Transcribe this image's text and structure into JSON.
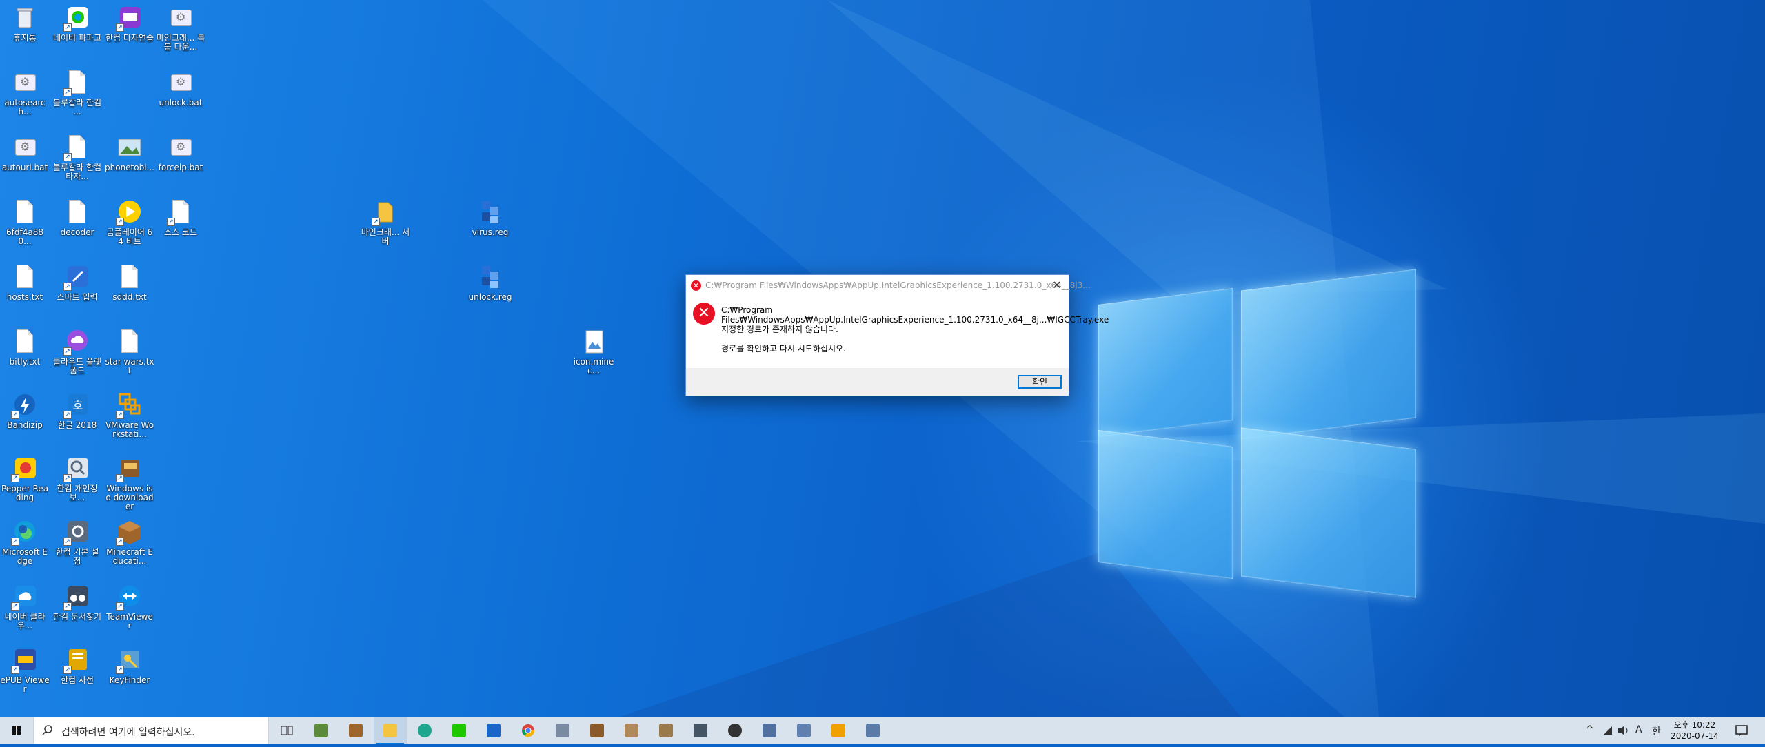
{
  "desktop_icons": [
    {
      "label": "휴지통"
    },
    {
      "label": "네이버 파파고"
    },
    {
      "label": "한컴 타자연습"
    },
    {
      "label": "마인크래... 복붙 다운..."
    },
    {
      "label": "autosearch..."
    },
    {
      "label": "블루칼라 한컴 ..."
    },
    {
      "label": "unlock.bat"
    },
    {
      "label": "autourl.bat"
    },
    {
      "label": "블루칼라 한컴타자..."
    },
    {
      "label": "phonetobi..."
    },
    {
      "label": "forceip.bat"
    },
    {
      "label": "6fdf4a880..."
    },
    {
      "label": "decoder"
    },
    {
      "label": "곰플레이어 64 비트"
    },
    {
      "label": "소스 코드"
    },
    {
      "label": "마인크래... 서버"
    },
    {
      "label": "virus.reg"
    },
    {
      "label": "hosts.txt"
    },
    {
      "label": "스마트 입력"
    },
    {
      "label": "sddd.txt"
    },
    {
      "label": "unlock.reg"
    },
    {
      "label": "bitly.txt"
    },
    {
      "label": "클라우드 플랫폼드"
    },
    {
      "label": "star wars.txt"
    },
    {
      "label": "icon.minec..."
    },
    {
      "label": "Bandizip"
    },
    {
      "label": "한글 2018"
    },
    {
      "label": "VMware Workstati..."
    },
    {
      "label": "Pepper Reading"
    },
    {
      "label": "한컴 개인정보..."
    },
    {
      "label": "Windows iso downloader"
    },
    {
      "label": "Microsoft Edge"
    },
    {
      "label": "한컴 기본 설정"
    },
    {
      "label": "Minecraft Educati..."
    },
    {
      "label": "네이버 클라우..."
    },
    {
      "label": "한컴 문서찾기"
    },
    {
      "label": "TeamViewer"
    },
    {
      "label": "ePUB Viewer"
    },
    {
      "label": "한컴 사전"
    },
    {
      "label": "KeyFinder"
    }
  ],
  "dialog": {
    "title": "C:₩Program Files₩WindowsApps₩AppUp.IntelGraphicsExperience_1.100.2731.0_x64__8j3...",
    "message_line1": "C:₩Program",
    "message_line2": "Files₩WindowsApps₩AppUp.IntelGraphicsExperience_1.100.2731.0_x64__8j...₩IGCCTray.exe",
    "message_line3": "지정한 경로가 존재하지 않습니다.",
    "message_line4": "경로를 확인하고 다시 시도하십시오.",
    "ok_label": "확인",
    "close_glyph": "✕",
    "error_glyph": "✕"
  },
  "taskbar": {
    "search_placeholder": "검색하려면 여기에 입력하십시오.",
    "apps": [
      "task-view",
      "minecraft",
      "minecraft-edu",
      "file-explorer",
      "edge-beta",
      "papago",
      "teamviewer-chat",
      "chrome",
      "hancom-tool",
      "minecraft-2",
      "pickaxe",
      "pickaxe-2",
      "network-tool",
      "chat-tool",
      "remote-1",
      "remote-2",
      "vmware",
      "remote-3"
    ],
    "active_app": "file-explorer",
    "tray": {
      "chevron": "^",
      "ime_mode": "A",
      "ime_lang": "한",
      "time": "오후 10:22",
      "date": "2020-07-14"
    }
  },
  "colors": {
    "desktop_blue": "#0f6fd6",
    "error_red": "#e81123",
    "accent": "#0078d7",
    "taskbar": "#d9e3ee"
  }
}
